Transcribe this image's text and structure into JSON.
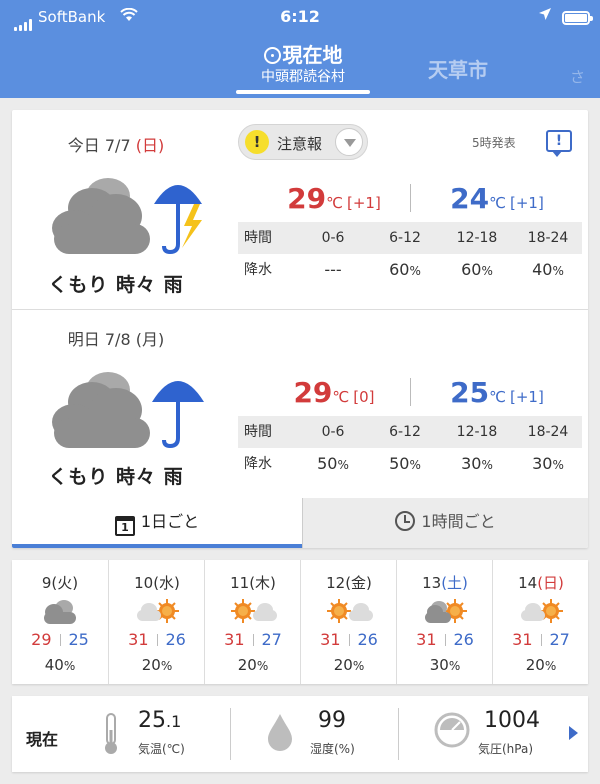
{
  "status_bar": {
    "carrier": "SoftBank",
    "time": "6:12"
  },
  "header": {
    "current_tab_title": "現在地",
    "current_tab_sub": "中頭郡読谷村",
    "other_tab": "天草市",
    "faded_tab": "さ"
  },
  "issued": "5時発表",
  "alert": {
    "label": "注意報",
    "mark": "!"
  },
  "today": {
    "date_prefix": "今日 7/7 ",
    "weekday": "(日)",
    "condition": "くもり 時々 雨",
    "high": "29",
    "high_diff": "[+1]",
    "low": "24",
    "low_diff": "[+1]",
    "precip": [
      "---",
      "60",
      "60",
      "40"
    ]
  },
  "tomorrow": {
    "date_prefix": "明日 7/8 ",
    "weekday": "(月)",
    "condition": "くもり 時々 雨",
    "high": "29",
    "high_diff": "[0]",
    "low": "25",
    "low_diff": "[+1]",
    "precip": [
      "50",
      "50",
      "30",
      "30"
    ]
  },
  "table": {
    "time_label": "時間",
    "precip_label": "降水",
    "periods": [
      "0-6",
      "6-12",
      "12-18",
      "18-24"
    ],
    "pct_unit": "%"
  },
  "units": {
    "celsius": "℃"
  },
  "tabs": {
    "daily": "1日ごと",
    "hourly": "1時間ごと",
    "cal_digit": "1"
  },
  "week": [
    {
      "day": "9",
      "wd": "(火)",
      "wd_type": "normal",
      "hi": "29",
      "lo": "25",
      "pop": "40",
      "icon": "cloud-icon"
    },
    {
      "day": "10",
      "wd": "(水)",
      "wd_type": "normal",
      "hi": "31",
      "lo": "26",
      "pop": "20",
      "icon": "cloud-sun-icon"
    },
    {
      "day": "11",
      "wd": "(木)",
      "wd_type": "normal",
      "hi": "31",
      "lo": "27",
      "pop": "20",
      "icon": "sun-cloud-icon"
    },
    {
      "day": "12",
      "wd": "(金)",
      "wd_type": "normal",
      "hi": "31",
      "lo": "26",
      "pop": "20",
      "icon": "sun-cloud-icon"
    },
    {
      "day": "13",
      "wd": "(土)",
      "wd_type": "sat",
      "hi": "31",
      "lo": "26",
      "pop": "30",
      "icon": "cloud-sun-icon"
    },
    {
      "day": "14",
      "wd": "(日)",
      "wd_type": "sun",
      "hi": "31",
      "lo": "27",
      "pop": "20",
      "icon": "cloud-sun-icon"
    }
  ],
  "current": {
    "label": "現在",
    "temp_int": "25",
    "temp_dec": ".1",
    "temp_caption": "気温(℃)",
    "humidity": "99",
    "humidity_caption": "湿度(%)",
    "pressure": "1004",
    "pressure_caption": "気圧(hPa)"
  },
  "colors": {
    "header_blue": "#5b8fdf",
    "high_red": "#d23b3b",
    "low_blue": "#3e6bc8",
    "alert_yellow": "#f6de2c",
    "sun_orange": "#f08a24"
  }
}
